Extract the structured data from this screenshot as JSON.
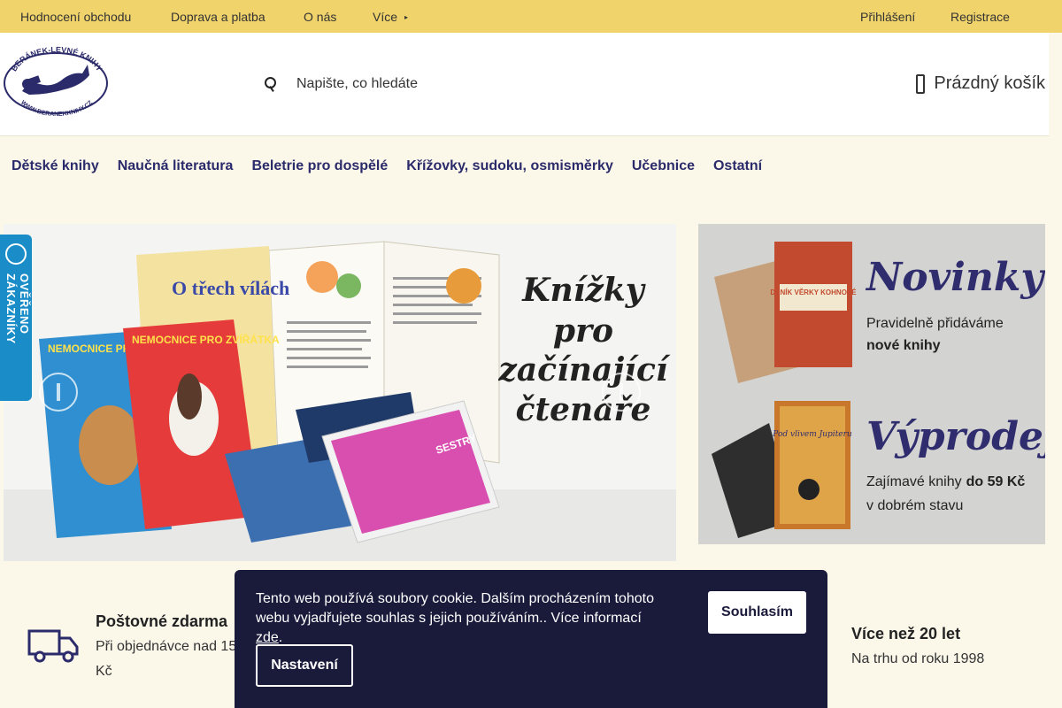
{
  "topbar": {
    "left_links": [
      "Hodnocení obchodu",
      "Doprava a platba",
      "O nás",
      "Více"
    ],
    "login": "Přihlášení",
    "register": "Registrace"
  },
  "header": {
    "logo_text_top": "BERÁNEK-LEVNÉ KNIHY",
    "logo_text_bottom": "WWW.BERANEKKNIHY.CZ",
    "search_placeholder": "Napište, co hledáte",
    "cart_label": "Prázdný košík"
  },
  "categories": [
    "Dětské knihy",
    "Naučná literatura",
    "Beletrie pro dospělé",
    "Křížovky, sudoku, osmisměrky",
    "Učebnice",
    "Ostatní"
  ],
  "slider": {
    "headline_lines": [
      "Knížky",
      "pro",
      "začínající",
      "čtenáře"
    ],
    "book_titles": [
      "O třech vílách",
      "NEMOCNICE PRO ZVÍŘÁTA",
      "NEMOCNICE PRO ZVÍŘÁTKA",
      "SESTRY"
    ]
  },
  "promo": {
    "novinky_title": "Novinky",
    "novinky_line1": "Pravidelně přidáváme",
    "novinky_line2": "nové knihy",
    "novinky_book": "DENÍK VĚRKY KOHNOVÉ",
    "vyprodej_title": "Výprodej",
    "vyprodej_line1": "Zajímavé knihy",
    "vyprodej_line1_bold": "do 59 Kč",
    "vyprodej_line2": "v dobrém stavu",
    "vyprodej_book": "Pod vlivem Jupiteru"
  },
  "badge": {
    "label": "OVĚŘENO ZÁKAZNÍKY"
  },
  "features": [
    {
      "title": "Poštovné zdarma",
      "text_lines": [
        "Při objednávce nad 15",
        "Kč"
      ]
    },
    {
      "title": "Více než 20 let",
      "text_lines": [
        "Na trhu od roku 1998"
      ]
    }
  ],
  "cookie": {
    "message": "Tento web používá soubory cookie. Dalším procházením tohoto webu vyjadřujete souhlas s jejich používáním.. Více informací ",
    "link": "zde",
    "after_link": ".",
    "agree": "Souhlasím",
    "settings": "Nastavení"
  },
  "colors": {
    "topbar": "#f0d36b",
    "nav_text": "#2b2a6a",
    "cookie_bg": "#1a1a3b",
    "badge": "#1a8cc7"
  }
}
